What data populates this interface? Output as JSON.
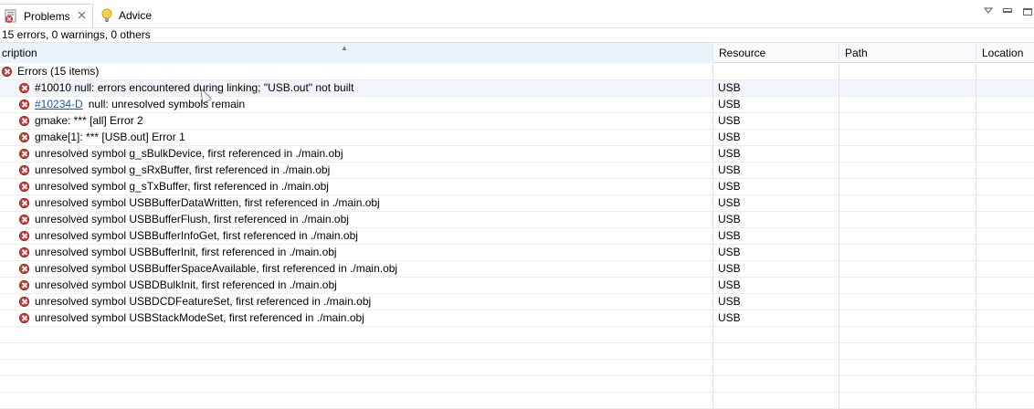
{
  "tabs": [
    {
      "label": "Problems",
      "icon": "problems-icon",
      "active": true
    },
    {
      "label": "Advice",
      "icon": "lightbulb-icon",
      "active": false
    }
  ],
  "summary": "15 errors, 0 warnings, 0 others",
  "columns": {
    "description": "cription",
    "resource": "Resource",
    "path": "Path",
    "location": "Location"
  },
  "group": {
    "label": "Errors (15 items)"
  },
  "errors": [
    {
      "link": "",
      "text": "#10010 null: errors encountered during linking; \"USB.out\" not built",
      "resource": "USB"
    },
    {
      "link": "#10234-D",
      "text": "null: unresolved symbols remain",
      "resource": "USB"
    },
    {
      "link": "",
      "text": "gmake: *** [all] Error 2",
      "resource": "USB"
    },
    {
      "link": "",
      "text": "gmake[1]: *** [USB.out] Error 1",
      "resource": "USB"
    },
    {
      "link": "",
      "text": "unresolved symbol g_sBulkDevice, first referenced in ./main.obj",
      "resource": "USB"
    },
    {
      "link": "",
      "text": "unresolved symbol g_sRxBuffer, first referenced in ./main.obj",
      "resource": "USB"
    },
    {
      "link": "",
      "text": "unresolved symbol g_sTxBuffer, first referenced in ./main.obj",
      "resource": "USB"
    },
    {
      "link": "",
      "text": "unresolved symbol USBBufferDataWritten, first referenced in ./main.obj",
      "resource": "USB"
    },
    {
      "link": "",
      "text": "unresolved symbol USBBufferFlush, first referenced in ./main.obj",
      "resource": "USB"
    },
    {
      "link": "",
      "text": "unresolved symbol USBBufferInfoGet, first referenced in ./main.obj",
      "resource": "USB"
    },
    {
      "link": "",
      "text": "unresolved symbol USBBufferInit, first referenced in ./main.obj",
      "resource": "USB"
    },
    {
      "link": "",
      "text": "unresolved symbol USBBufferSpaceAvailable, first referenced in ./main.obj",
      "resource": "USB"
    },
    {
      "link": "",
      "text": "unresolved symbol USBDBulkInit, first referenced in ./main.obj",
      "resource": "USB"
    },
    {
      "link": "",
      "text": "unresolved symbol USBDCDFeatureSet, first referenced in ./main.obj",
      "resource": "USB"
    },
    {
      "link": "",
      "text": "unresolved symbol USBStackModeSet, first referenced in ./main.obj",
      "resource": "USB"
    }
  ],
  "colors": {
    "error": "#d23b34",
    "link": "#1a55c5",
    "header_sorted": "#eaf3fb"
  }
}
